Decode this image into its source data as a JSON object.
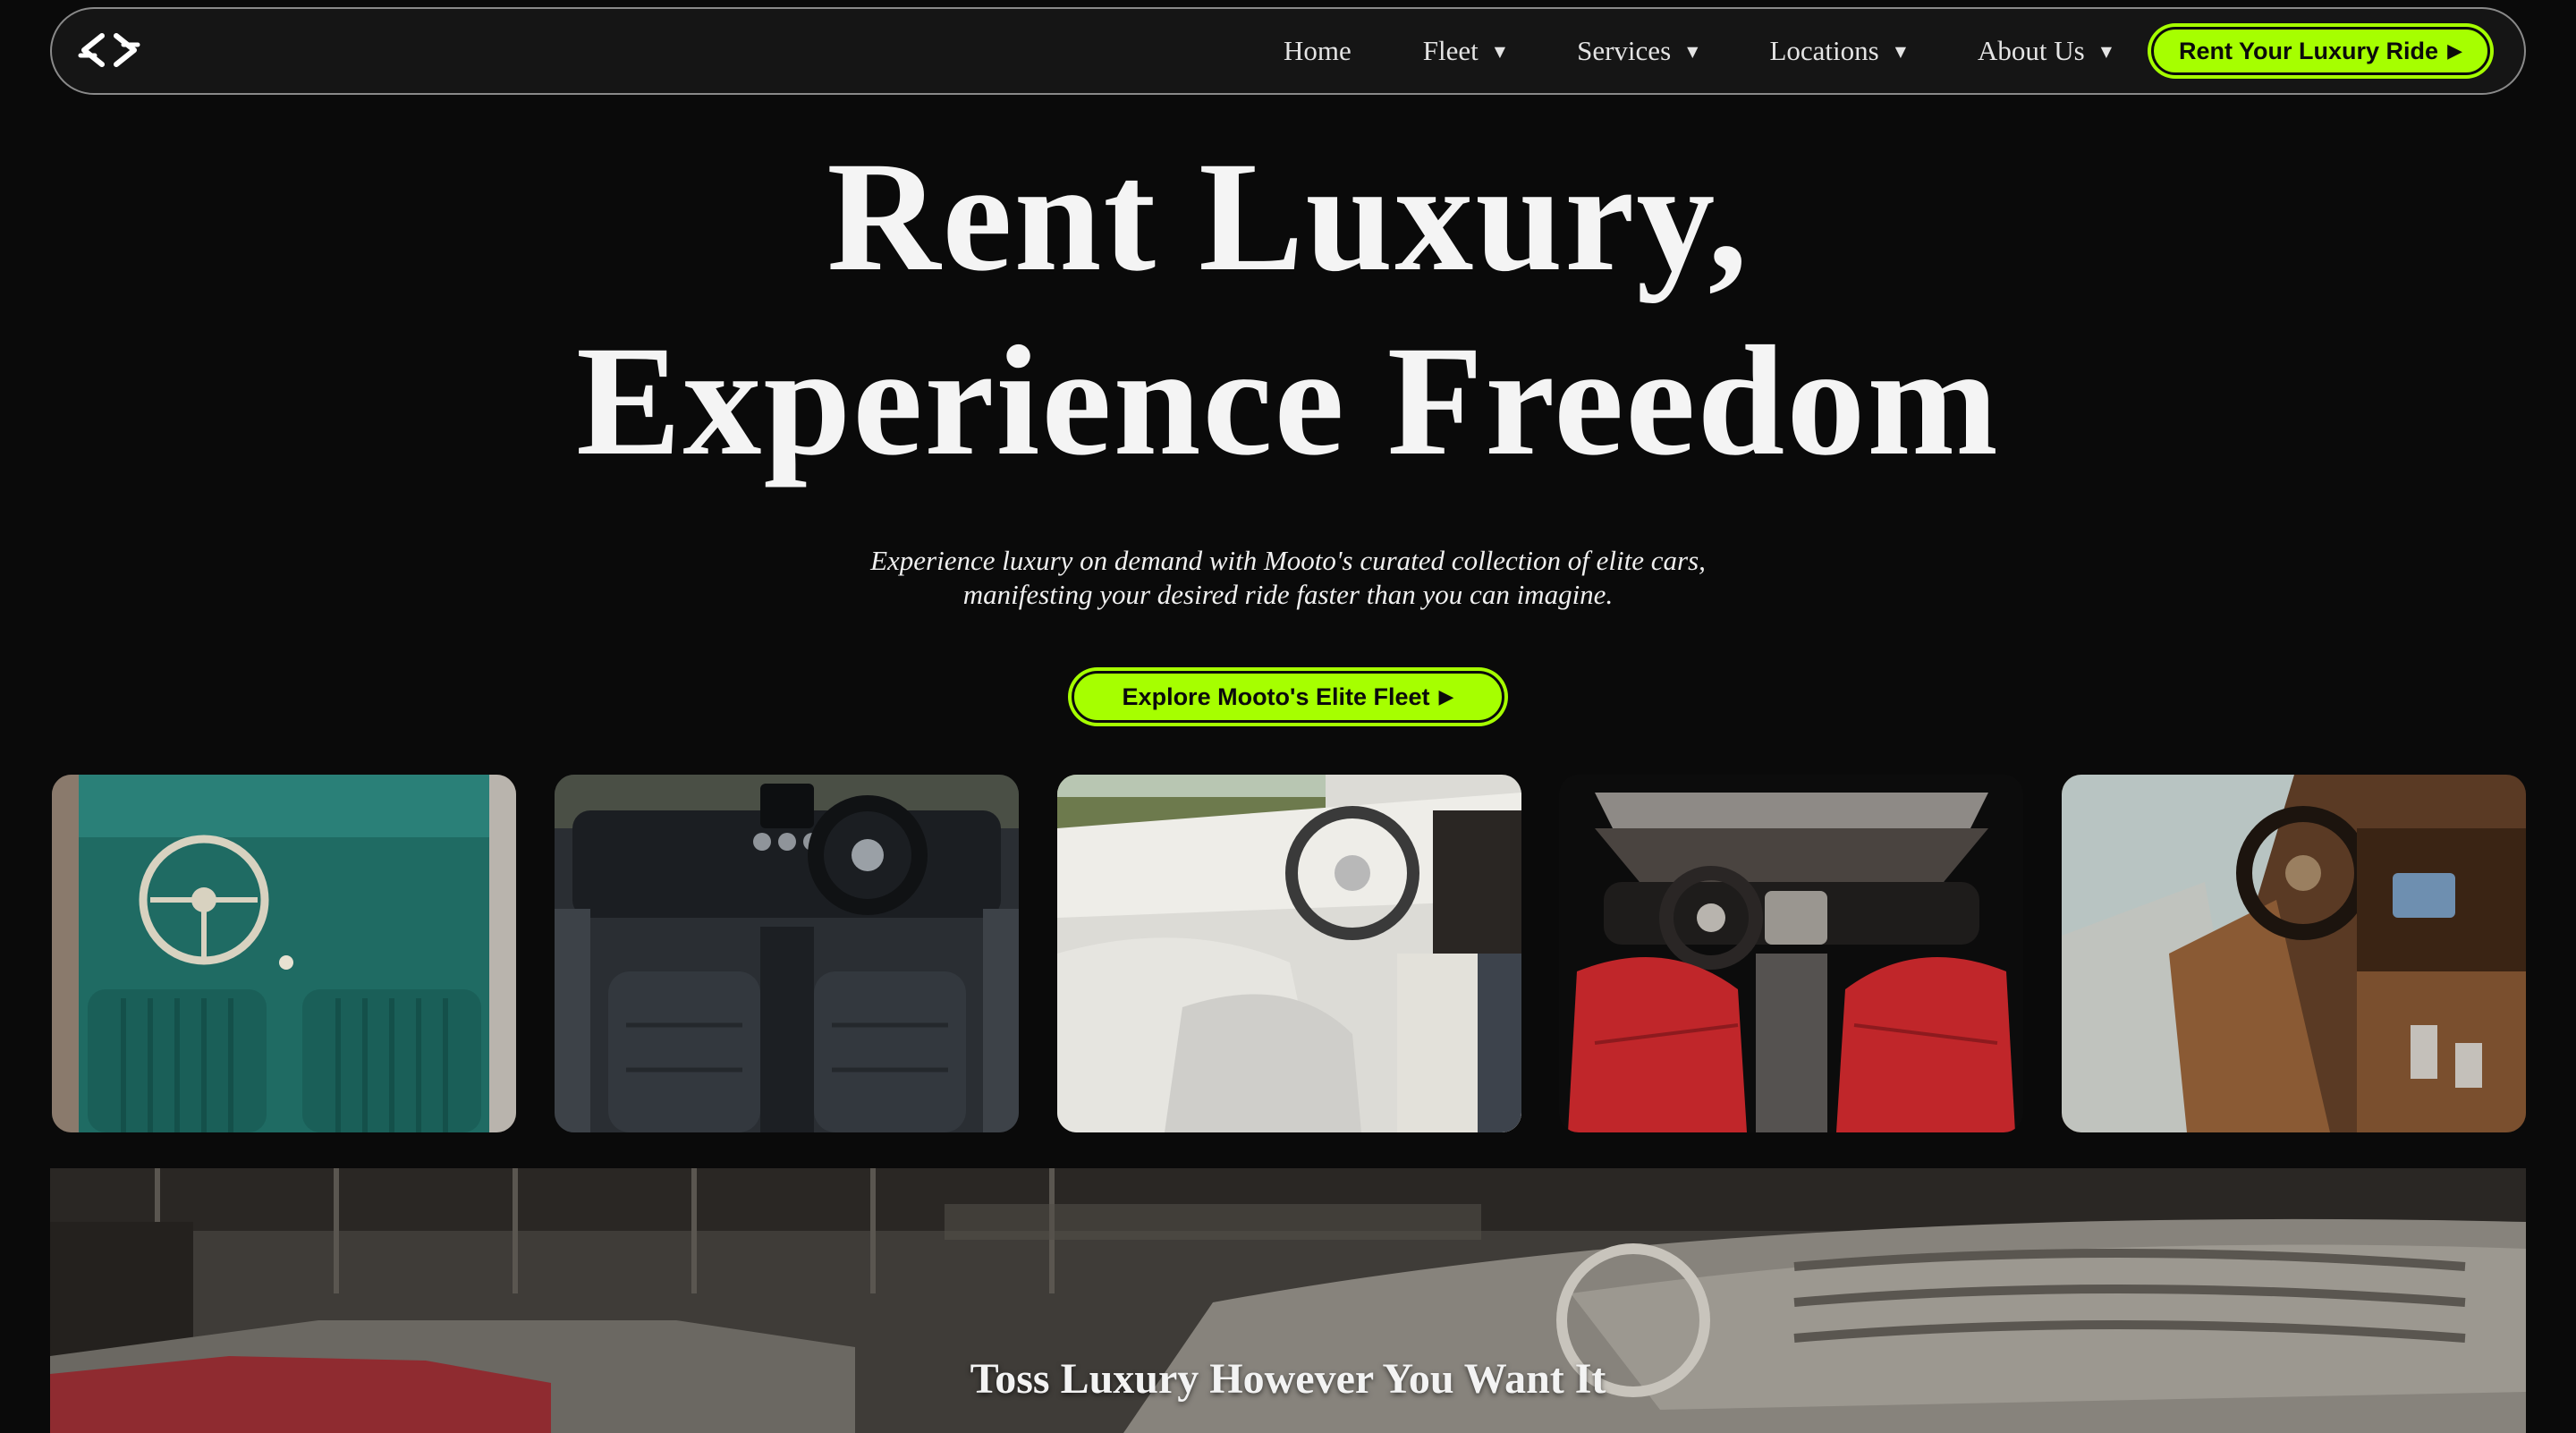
{
  "nav": {
    "items": [
      {
        "label": "Home",
        "has_dropdown": false
      },
      {
        "label": "Fleet",
        "has_dropdown": true
      },
      {
        "label": "Services",
        "has_dropdown": true
      },
      {
        "label": "Locations",
        "has_dropdown": true
      },
      {
        "label": "About Us",
        "has_dropdown": true
      }
    ],
    "caret_glyph": "▼",
    "cta_label": "Rent Your Luxury Ride",
    "arrow_glyph": "▶",
    "logo_icon": "mooto-logo-icon"
  },
  "hero": {
    "title_line1": "Rent Luxury,",
    "title_line2": "Experience Freedom",
    "subtitle_line1": "Experience luxury on demand with Mooto's curated collection of elite cars,",
    "subtitle_line2": "manifesting your desired ride faster than you can imagine.",
    "button_label": "Explore Mooto's Elite Fleet"
  },
  "gallery": {
    "images": [
      {
        "name": "teal-vintage-interior"
      },
      {
        "name": "black-leather-interior"
      },
      {
        "name": "white-leather-interior"
      },
      {
        "name": "red-leather-interior"
      },
      {
        "name": "tan-leather-interior"
      }
    ]
  },
  "banner": {
    "title": "Toss Luxury However You Want It"
  },
  "colors": {
    "accent": "#a6ff00",
    "background": "#0a0a0a",
    "nav_background": "#151515",
    "text": "#f2f2f2"
  }
}
